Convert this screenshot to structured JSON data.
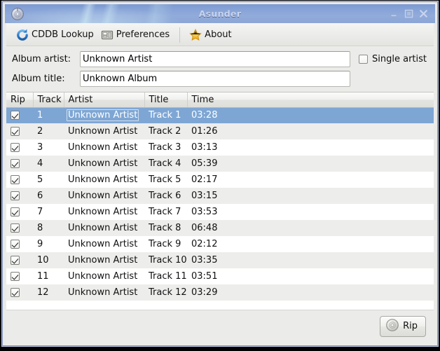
{
  "window": {
    "title": "Asunder",
    "icon": "cd-disc-icon",
    "controls": {
      "minimize": "minimize-button",
      "maximize": "maximize-button",
      "close": "close-button"
    }
  },
  "toolbar": {
    "items": [
      {
        "label": "CDDB Lookup",
        "icon": "refresh-circle-icon"
      },
      {
        "label": "Preferences",
        "icon": "preferences-panel-icon"
      },
      {
        "label": "About",
        "icon": "star-icon"
      }
    ]
  },
  "form": {
    "album_artist": {
      "label": "Album artist:",
      "value": "Unknown Artist",
      "placeholder": ""
    },
    "album_title": {
      "label": "Album title:",
      "value": "Unknown Album",
      "placeholder": ""
    },
    "single_artist": {
      "label": "Single artist",
      "checked": false
    }
  },
  "table": {
    "columns": [
      "Rip",
      "Track",
      "Artist",
      "Title",
      "Time"
    ],
    "selected_row_index": 0,
    "rows": [
      {
        "rip": true,
        "track": "1",
        "artist": "Unknown Artist",
        "title": "Track 1",
        "time": "03:28"
      },
      {
        "rip": true,
        "track": "2",
        "artist": "Unknown Artist",
        "title": "Track 2",
        "time": "01:26"
      },
      {
        "rip": true,
        "track": "3",
        "artist": "Unknown Artist",
        "title": "Track 3",
        "time": "03:13"
      },
      {
        "rip": true,
        "track": "4",
        "artist": "Unknown Artist",
        "title": "Track 4",
        "time": "05:39"
      },
      {
        "rip": true,
        "track": "5",
        "artist": "Unknown Artist",
        "title": "Track 5",
        "time": "02:17"
      },
      {
        "rip": true,
        "track": "6",
        "artist": "Unknown Artist",
        "title": "Track 6",
        "time": "03:15"
      },
      {
        "rip": true,
        "track": "7",
        "artist": "Unknown Artist",
        "title": "Track 7",
        "time": "03:53"
      },
      {
        "rip": true,
        "track": "8",
        "artist": "Unknown Artist",
        "title": "Track 8",
        "time": "06:48"
      },
      {
        "rip": true,
        "track": "9",
        "artist": "Unknown Artist",
        "title": "Track 9",
        "time": "02:12"
      },
      {
        "rip": true,
        "track": "10",
        "artist": "Unknown Artist",
        "title": "Track 10",
        "time": "03:35"
      },
      {
        "rip": true,
        "track": "11",
        "artist": "Unknown Artist",
        "title": "Track 11",
        "time": "03:51"
      },
      {
        "rip": true,
        "track": "12",
        "artist": "Unknown Artist",
        "title": "Track 12",
        "time": "03:29"
      }
    ]
  },
  "bottom": {
    "rip_button": {
      "label": "Rip",
      "icon": "cd-disc-icon"
    }
  },
  "colors": {
    "titlebar_blue": "#8aa6d8",
    "selection_blue": "#7ea6d4",
    "window_bg": "#ebebe9",
    "row_stripe": "#ededeb",
    "accent_star": "#f5c020"
  }
}
